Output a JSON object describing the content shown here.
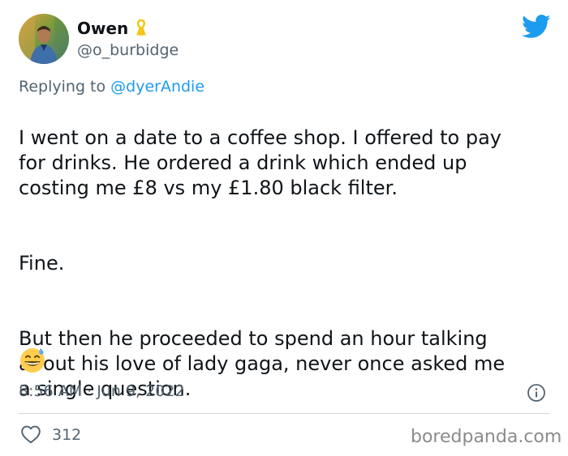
{
  "colors": {
    "twitter_blue": "#1d9bf0",
    "text_primary": "#0f1419",
    "text_secondary": "#536471",
    "ribbon_gold": "#f5c518",
    "divider": "#cfd9de"
  },
  "author": {
    "display_name": "Owen",
    "handle": "@o_burbidge",
    "badge_icon": "yellow-ribbon-icon"
  },
  "reply": {
    "prefix": "Replying to ",
    "mention": "@dyerAndie"
  },
  "tweet": {
    "paragraph_1": "I went on a date to a coffee shop. I offered to pay\nfor drinks. He ordered a drink which ended up\ncosting me £8 vs my £1.80 black filter.",
    "paragraph_2": "Fine.",
    "paragraph_3": "But then he proceeded to spend an hour talking\nabout his love of lady gaga, never once asked me\na single question.",
    "emoji": "😅",
    "timestamp": "8:56 AM · Jun 9, 2022"
  },
  "actions": {
    "like_count": "312",
    "like_icon": "heart-icon",
    "info_icon": "info-icon"
  },
  "watermark": "boredpanda.com"
}
